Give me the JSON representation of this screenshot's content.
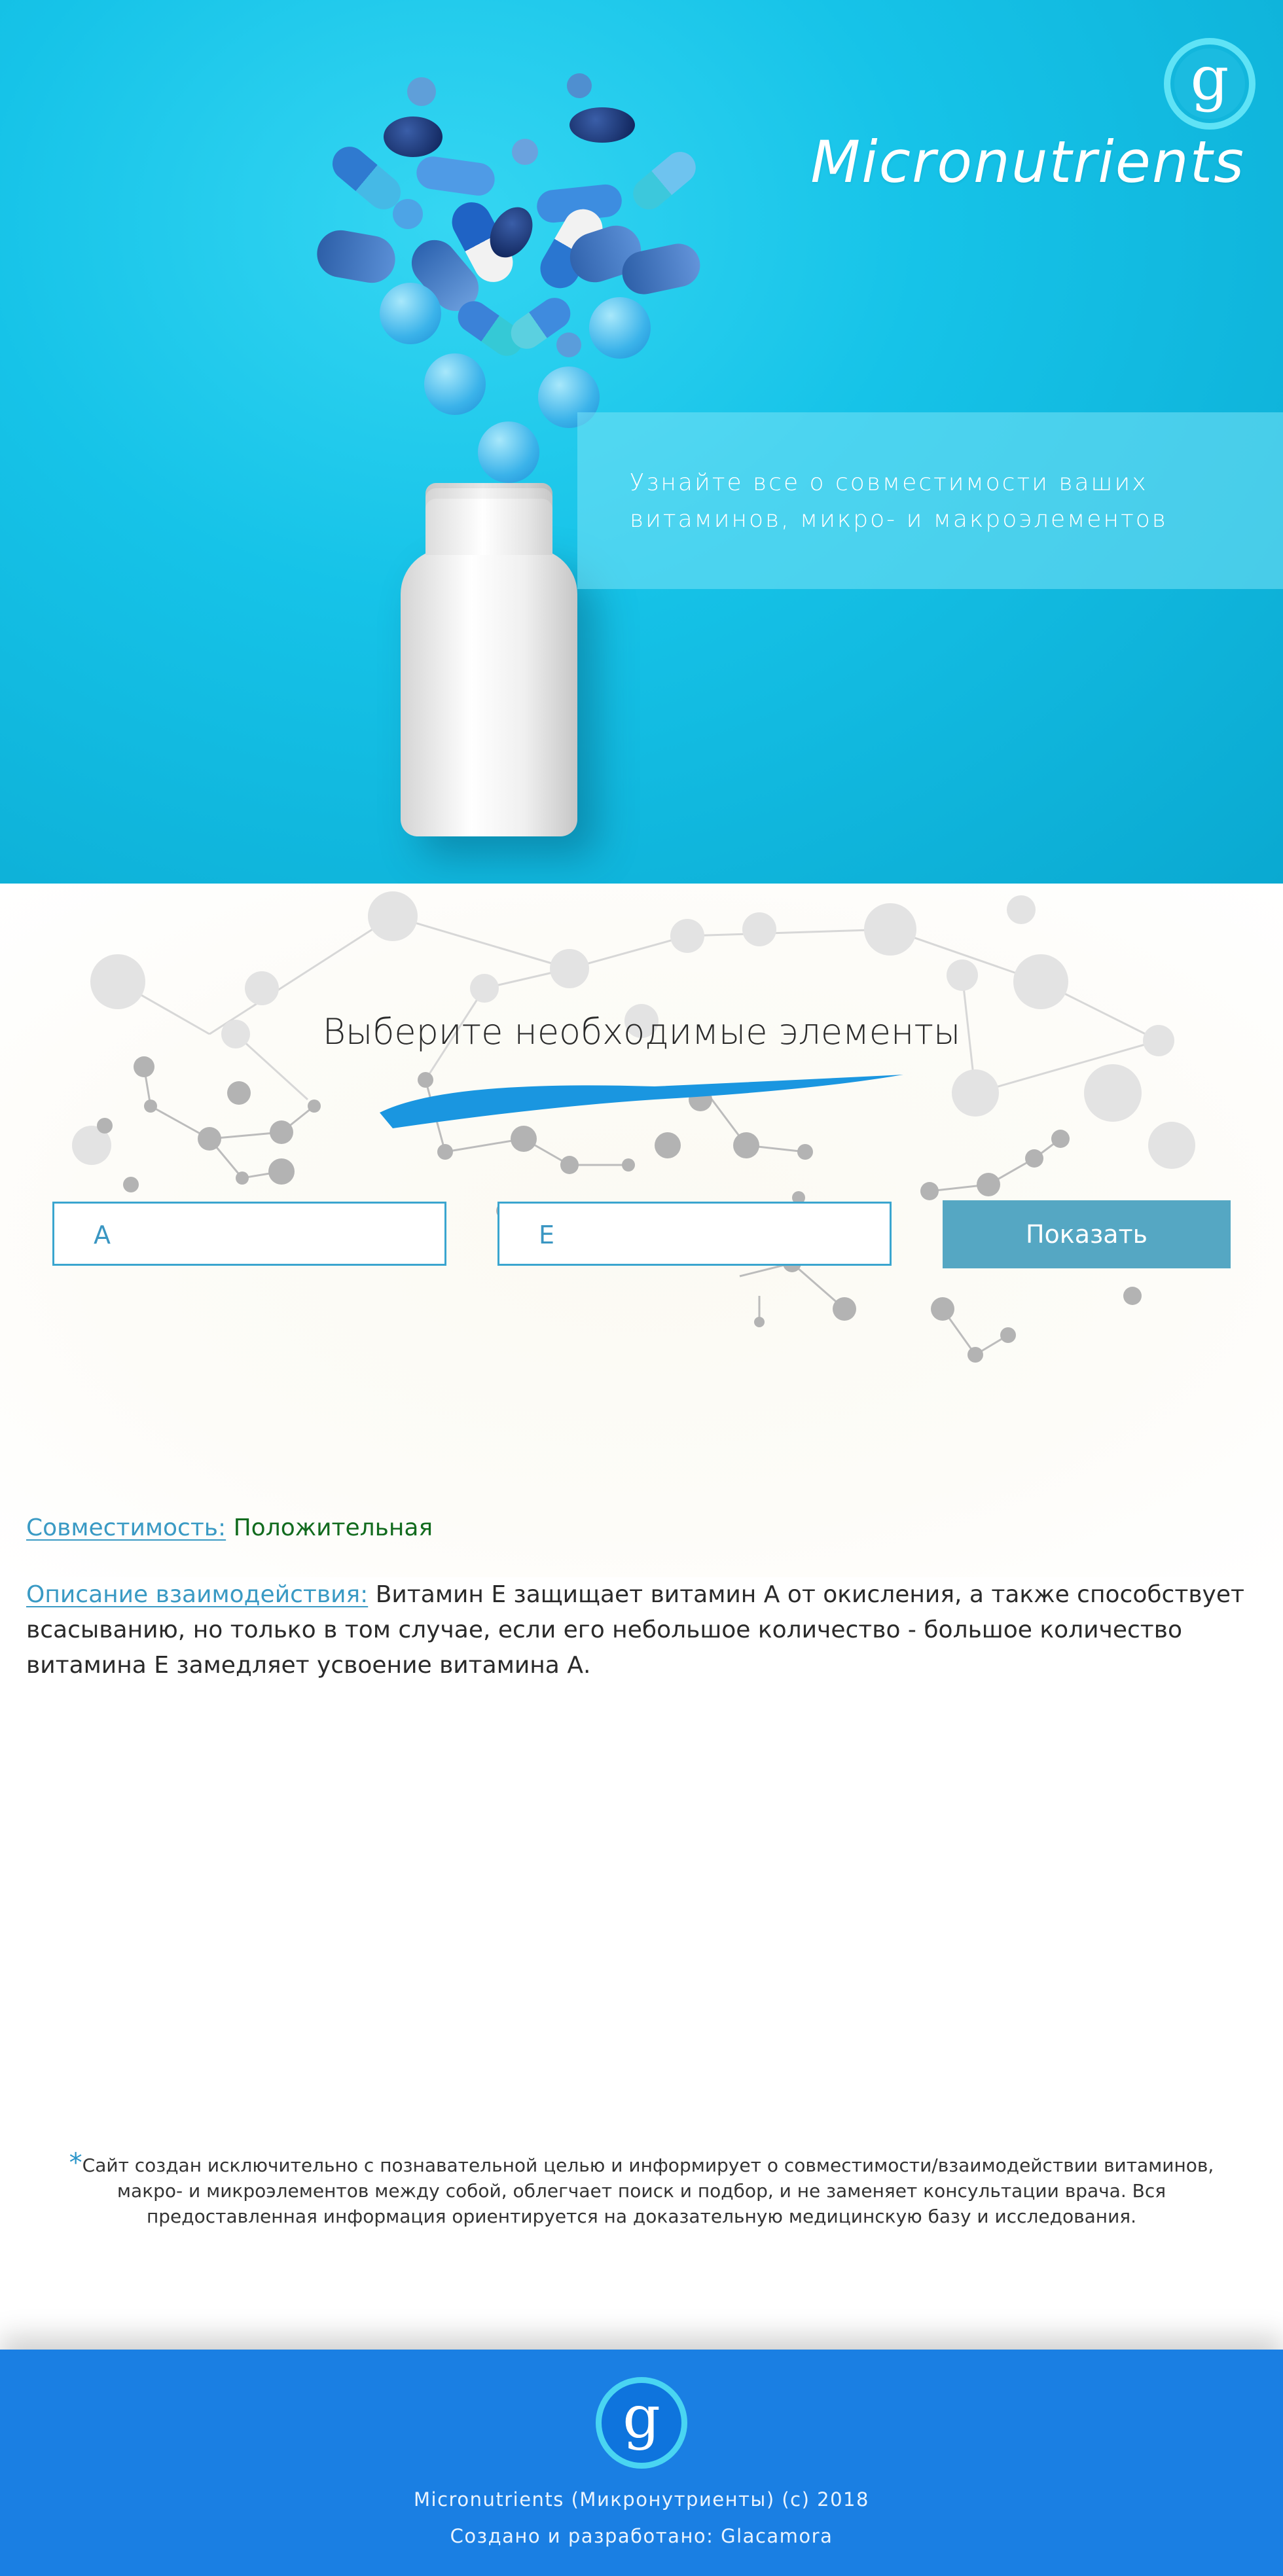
{
  "hero": {
    "logo_letter": "g",
    "brand": "Micronutrients",
    "tagline": "Узнайте все о совместимости ваших витаминов, микро- и макроэлементов",
    "bg_color": "#16c3e8"
  },
  "selector": {
    "title": "Выберите необходимые элементы",
    "element_a": "A",
    "element_b": "E",
    "show_label": "Показать",
    "button_color": "#55a7c3"
  },
  "result": {
    "compat_label": "Совместимость:",
    "compat_value": "Положительная",
    "desc_label": "Описание взаимодействия:",
    "desc_text": "Витамин Е защищает витамин А от окисления, а также способствует всасыванию, но только в том случае, если его небольшое количество - большое количество витамина Е замедляет усвоение витамина А."
  },
  "disclaimer": {
    "star": "*",
    "text": "Сайт создан исключительно с познавательной целью и информирует о совместимости/взаимодействии витаминов, макро- и микроэлементов между собой, облегчает поиск и подбор, и не заменяет консультации врача. Вся предоставленная информация ориентируется на доказательную медицинскую базу и исследования."
  },
  "footer": {
    "logo_letter": "g",
    "copyright": "Micronutrients (Микронутриенты) (c) 2018",
    "credits": "Создано и разработано: Glacamora",
    "bg_color": "#1a7fe3"
  }
}
